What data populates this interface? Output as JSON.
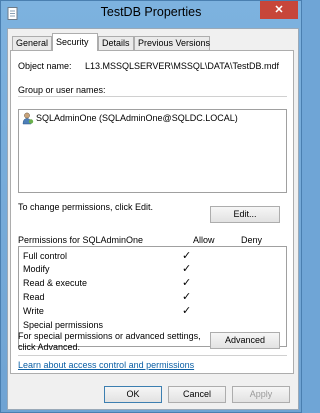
{
  "window": {
    "title": "TestDB Properties",
    "close_glyph": "✕"
  },
  "tabs": [
    {
      "label": "General"
    },
    {
      "label": "Security"
    },
    {
      "label": "Details"
    },
    {
      "label": "Previous Versions"
    }
  ],
  "object": {
    "label": "Object name:",
    "value": "L13.MSSQLSERVER\\MSSQL\\DATA\\TestDB.mdf"
  },
  "groups": {
    "label": "Group or user names:",
    "users": [
      {
        "label": "SQLAdminOne (SQLAdminOne@SQLDC.LOCAL)",
        "icon": "user-icon"
      }
    ]
  },
  "change_text": "To change permissions, click Edit.",
  "edit_button": "Edit...",
  "permissions": {
    "header_label": "Permissions for SQLAdminOne",
    "allow_header": "Allow",
    "deny_header": "Deny",
    "rows": [
      {
        "name": "Full control",
        "allow": "✓",
        "deny": ""
      },
      {
        "name": "Modify",
        "allow": "✓",
        "deny": ""
      },
      {
        "name": "Read & execute",
        "allow": "✓",
        "deny": ""
      },
      {
        "name": "Read",
        "allow": "✓",
        "deny": ""
      },
      {
        "name": "Write",
        "allow": "✓",
        "deny": ""
      },
      {
        "name": "Special permissions",
        "allow": "",
        "deny": ""
      }
    ]
  },
  "special": {
    "line1": "For special permissions or advanced settings,",
    "line2": "click Advanced.",
    "advanced_button": "Advanced"
  },
  "learn_link": "Learn about access control and permissions",
  "footer": {
    "ok": "OK",
    "cancel": "Cancel",
    "apply": "Apply"
  }
}
